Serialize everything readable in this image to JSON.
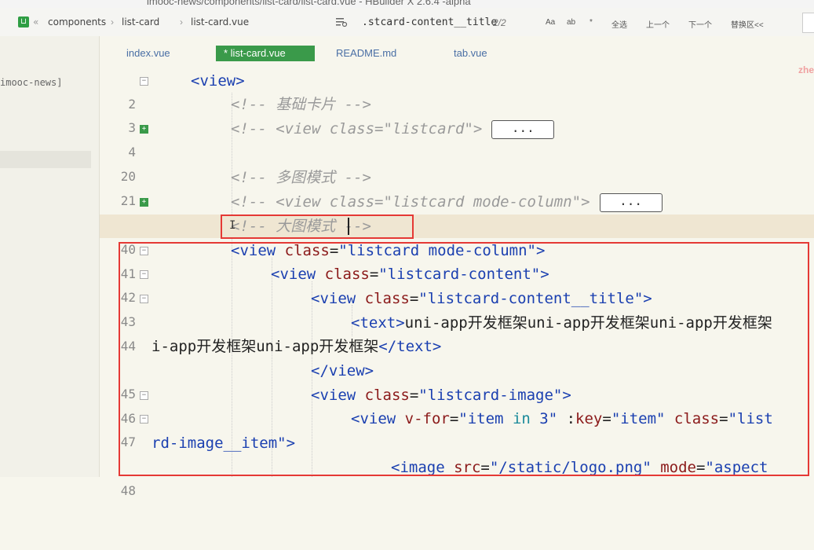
{
  "window_title": "imooc-news/components/list-card/list-card.vue - HBuilder X 2.6.4 -alpha",
  "breadcrumb": {
    "nav_back": "«",
    "items": [
      "components",
      "list-card",
      "list-card.vue"
    ],
    "sep": "›"
  },
  "find": {
    "query": ".stcard-content__title",
    "count": "2/2",
    "buttons": [
      "Aa",
      "ab",
      "*",
      "全选",
      "上一个",
      "下一个",
      "替换区<<"
    ]
  },
  "sidebar": {
    "project_label": "imooc-news]"
  },
  "tabs": [
    {
      "label": "index.vue",
      "active": false
    },
    {
      "label": "* list-card.vue",
      "active": true
    },
    {
      "label": "README.md",
      "active": false
    },
    {
      "label": "tab.vue",
      "active": false
    }
  ],
  "overflow_text": "zhe",
  "editor": {
    "lines": [
      {
        "num": "2",
        "fold": "open"
      },
      {
        "num": "3",
        "fold": ""
      },
      {
        "num": "4",
        "fold": "closed"
      },
      {
        "num": "20",
        "fold": ""
      },
      {
        "num": "21",
        "fold": ""
      },
      {
        "num": "22",
        "fold": "closed"
      },
      {
        "num": "40",
        "fold": ""
      },
      {
        "num": "41",
        "fold": "open"
      },
      {
        "num": "42",
        "fold": "open"
      },
      {
        "num": "43",
        "fold": "open"
      },
      {
        "num": "44",
        "fold": ""
      },
      {
        "num": "",
        "fold": ""
      },
      {
        "num": "45",
        "fold": ""
      },
      {
        "num": "46",
        "fold": "open"
      },
      {
        "num": "47",
        "fold": "open"
      },
      {
        "num": "",
        "fold": ""
      },
      {
        "num": "48",
        "fold": ""
      }
    ],
    "code": {
      "l2": "<view>",
      "l3": "<!-- 基础卡片 -->",
      "l4_prefix": "<!-- <view class=\"listcard\">",
      "collapsed": "...",
      "l21": "<!-- 多图模式 -->",
      "l22_prefix": "<!-- <view class=\"listcard mode-column\">",
      "l40": "<!-- 大图模式 -->",
      "l41": [
        "<view ",
        "class",
        "=",
        "\"listcard mode-column\"",
        ">"
      ],
      "l42": [
        "<view ",
        "class",
        "=",
        "\"listcard-content\"",
        ">"
      ],
      "l43": [
        "<view ",
        "class",
        "=",
        "\"listcard-content__title\"",
        ">"
      ],
      "l44": [
        "<text>",
        "uni-app开发框架uni-app开发框架uni-app开发框架"
      ],
      "l44b": [
        "i-app开发框架uni-app开发框架",
        "</text>"
      ],
      "l45": "</view>",
      "l46": [
        "<view ",
        "class",
        "=",
        "\"listcard-image\"",
        ">"
      ],
      "l47": [
        "<view ",
        "v-for",
        "=",
        "\"item ",
        "in",
        " 3\"",
        " :",
        "key",
        "=",
        "\"item\"",
        " class",
        "=",
        "\"list"
      ],
      "l47b": [
        "rd-image__item\"",
        ">"
      ],
      "l48": [
        "<image ",
        "src",
        "=",
        "\"/static/logo.png\"",
        " mode",
        "=",
        "\"aspect"
      ]
    }
  },
  "colors": {
    "tag": "#1a3fb0",
    "attr": "#8b1a1a",
    "comment": "#9a9a9a",
    "active_tab": "#3a9a4a",
    "annotation_red": "#e53935"
  }
}
